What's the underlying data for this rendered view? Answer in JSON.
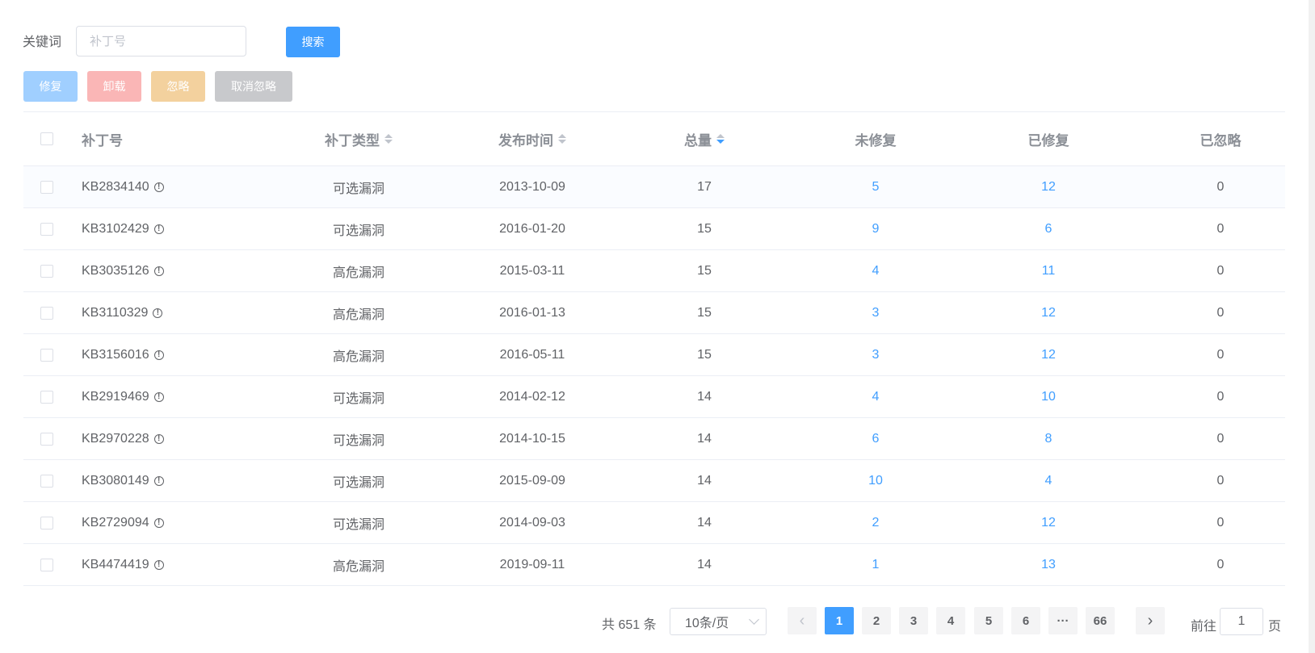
{
  "search": {
    "label": "关键词",
    "placeholder": "补丁号",
    "button": "搜索"
  },
  "actions": {
    "fix": "修复",
    "uninstall": "卸载",
    "ignore": "忽略",
    "unignore": "取消忽略"
  },
  "columns": {
    "kb": "补丁号",
    "type": "补丁类型",
    "date": "发布时间",
    "total": "总量",
    "unfixed": "未修复",
    "fixed": "已修复",
    "ignored": "已忽略"
  },
  "sort_active": "总量 descending",
  "rows": [
    {
      "kb": "KB2834140",
      "type": "可选漏洞",
      "date": "2013-10-09",
      "total": "17",
      "unfixed": "5",
      "fixed": "12",
      "ignored": "0"
    },
    {
      "kb": "KB3102429",
      "type": "可选漏洞",
      "date": "2016-01-20",
      "total": "15",
      "unfixed": "9",
      "fixed": "6",
      "ignored": "0"
    },
    {
      "kb": "KB3035126",
      "type": "高危漏洞",
      "date": "2015-03-11",
      "total": "15",
      "unfixed": "4",
      "fixed": "11",
      "ignored": "0"
    },
    {
      "kb": "KB3110329",
      "type": "高危漏洞",
      "date": "2016-01-13",
      "total": "15",
      "unfixed": "3",
      "fixed": "12",
      "ignored": "0"
    },
    {
      "kb": "KB3156016",
      "type": "高危漏洞",
      "date": "2016-05-11",
      "total": "15",
      "unfixed": "3",
      "fixed": "12",
      "ignored": "0"
    },
    {
      "kb": "KB2919469",
      "type": "可选漏洞",
      "date": "2014-02-12",
      "total": "14",
      "unfixed": "4",
      "fixed": "10",
      "ignored": "0"
    },
    {
      "kb": "KB2970228",
      "type": "可选漏洞",
      "date": "2014-10-15",
      "total": "14",
      "unfixed": "6",
      "fixed": "8",
      "ignored": "0"
    },
    {
      "kb": "KB3080149",
      "type": "可选漏洞",
      "date": "2015-09-09",
      "total": "14",
      "unfixed": "10",
      "fixed": "4",
      "ignored": "0"
    },
    {
      "kb": "KB2729094",
      "type": "可选漏洞",
      "date": "2014-09-03",
      "total": "14",
      "unfixed": "2",
      "fixed": "12",
      "ignored": "0"
    },
    {
      "kb": "KB4474419",
      "type": "高危漏洞",
      "date": "2019-09-11",
      "total": "14",
      "unfixed": "1",
      "fixed": "13",
      "ignored": "0"
    }
  ],
  "pagination": {
    "total_text": "共 651 条",
    "page_size": "10条/页",
    "pages": [
      "1",
      "2",
      "3",
      "4",
      "5",
      "6",
      "···",
      "66"
    ],
    "current": "1",
    "goto_label": "前往",
    "goto_value": "1",
    "goto_suffix": "页"
  },
  "colors": {
    "primary": "#409eff",
    "fix_disabled": "#a0cfff",
    "uninstall_disabled": "#fab6b6",
    "ignore_disabled": "#f3d19e",
    "unignore_disabled": "#c8c9cc"
  }
}
